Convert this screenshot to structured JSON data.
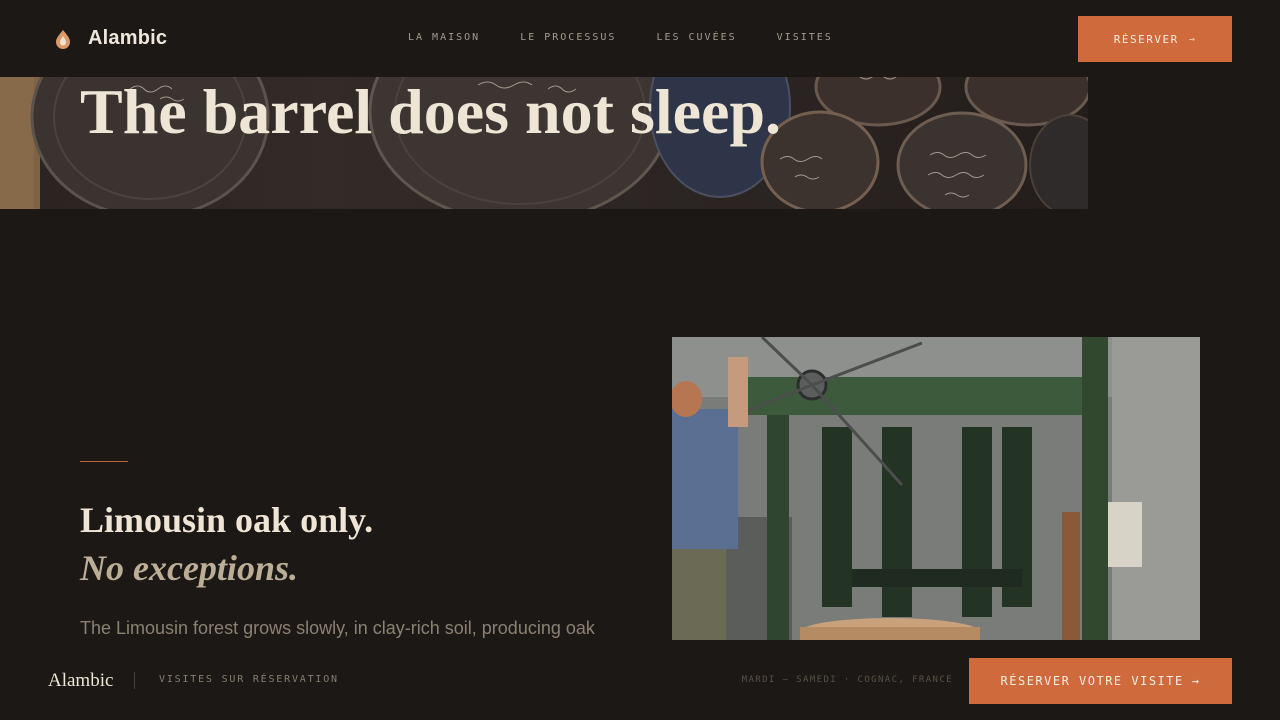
{
  "brand": {
    "name": "Alambic",
    "logo_icon": "flame-drop-icon"
  },
  "nav": {
    "links": [
      {
        "label": "LA MAISON"
      },
      {
        "label": "LE PROCESSUS"
      },
      {
        "label": "LES CUVÉES"
      },
      {
        "label": "VISITES"
      }
    ],
    "cta_label": "RÉSERVER",
    "cta_arrow": "→"
  },
  "hero": {
    "title": "The barrel does not sleep."
  },
  "section": {
    "heading_line1": "Limousin oak only.",
    "heading_line2": "No exceptions.",
    "body": "The Limousin forest grows slowly, in clay-rich soil, producing oak"
  },
  "footer": {
    "brand": "Alambic",
    "note": "VISITES SUR RÉSERVATION",
    "info": "MARDI – SAMEDI · COGNAC, FRANCE",
    "cta_label": "RÉSERVER VOTRE VISITE",
    "cta_arrow": "→"
  },
  "colors": {
    "background": "#1c1815",
    "accent": "#cf6a3c",
    "text_primary": "#eee5d5",
    "text_muted": "#8b8173",
    "text_italic": "#bcae96"
  }
}
